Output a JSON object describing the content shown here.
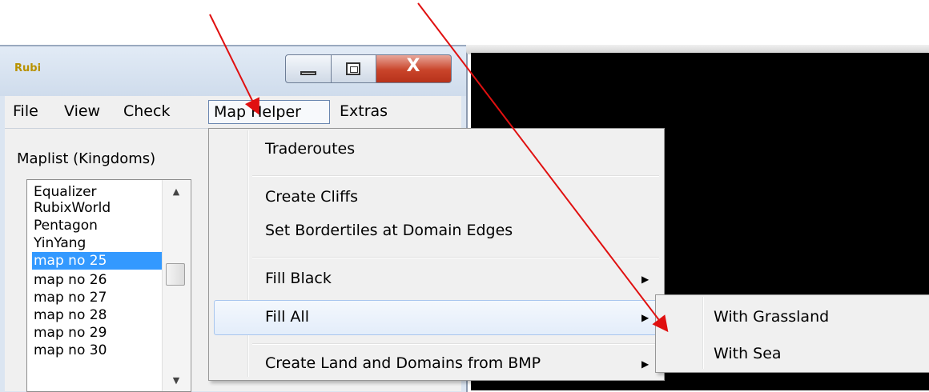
{
  "window": {
    "icon_text": "Rubi",
    "controls": {
      "minimize_icon": "minimize-icon",
      "maximize_icon": "maximize-icon",
      "close_label": "X"
    }
  },
  "menubar": {
    "items": [
      {
        "label": "File"
      },
      {
        "label": "View"
      },
      {
        "label": "Check"
      },
      {
        "label": "Map Helper",
        "active": true
      },
      {
        "label": "Extras"
      }
    ]
  },
  "maplist": {
    "title": "Maplist (Kingdoms)",
    "items": [
      "Equalizer",
      "RubixWorld",
      "Pentagon",
      "YinYang",
      "map no 25",
      "map no 26",
      "map no 27",
      "map no 28",
      "map no 29",
      "map no 30"
    ],
    "selected": "map no 25"
  },
  "map_helper_menu": {
    "items": [
      {
        "label": "Traderoutes"
      },
      {
        "label": "Create Cliffs"
      },
      {
        "label": "Set Bordertiles at Domain Edges"
      },
      {
        "label": "Fill Black",
        "submenu": true
      },
      {
        "label": "Fill All",
        "submenu": true,
        "highlighted": true
      },
      {
        "label": "Create Land and Domains from BMP",
        "submenu": true
      }
    ]
  },
  "fill_all_submenu": {
    "items": [
      {
        "label": "With Grassland"
      },
      {
        "label": "With Sea"
      }
    ]
  },
  "colors": {
    "selection": "#3399ff",
    "annotation_arrow": "#e01010",
    "close_button": "#c9442a"
  }
}
